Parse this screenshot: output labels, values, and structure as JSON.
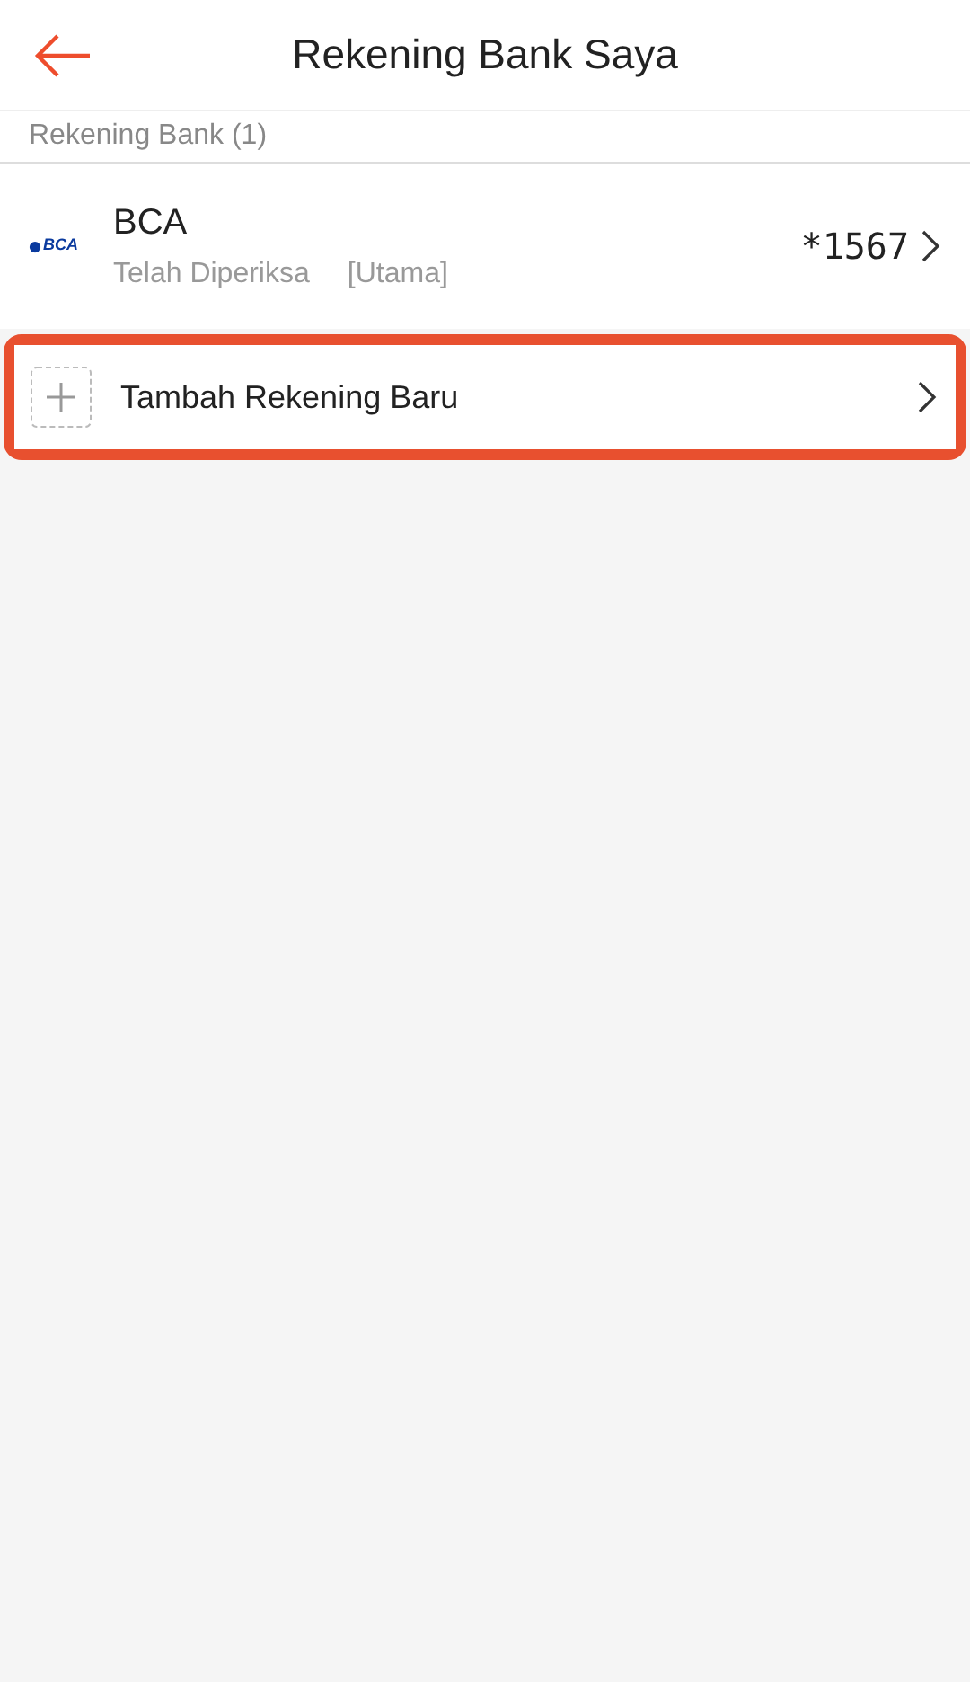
{
  "header": {
    "title": "Rekening Bank Saya"
  },
  "section": {
    "label": "Rekening Bank (1)"
  },
  "accounts": [
    {
      "logo_text": "BCA",
      "bank": "BCA",
      "status": "Telah Diperiksa",
      "tag": "[Utama]",
      "number": "*1567"
    }
  ],
  "add_account": {
    "label": "Tambah Rekening Baru",
    "highlighted": true
  }
}
